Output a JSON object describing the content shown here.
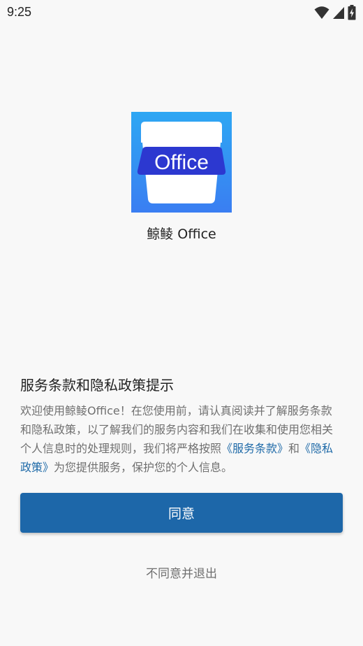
{
  "status_bar": {
    "time": "9:25",
    "icons": [
      "wifi-icon",
      "signal-icon",
      "battery-charging-icon"
    ]
  },
  "app": {
    "logo_text": "Office",
    "name": "鲸鲮 Office",
    "logo_colors": [
      "#2ea7f3",
      "#3a7ef2"
    ],
    "badge_color": "#2c38d0"
  },
  "dialog": {
    "title": "服务条款和隐私政策提示",
    "body_part1": "欢迎使用鲸鲮Office！在您使用前，请认真阅读并了解服务条款和隐私政策，以了解我们的服务内容和我们在收集和使用您相关个人信息时的处理规则，我们将严格按照",
    "terms_link": "《服务条款》",
    "body_part2": "和",
    "privacy_link": "《隐私政策》",
    "body_part3": "为您提供服务，保护您的个人信息。"
  },
  "buttons": {
    "agree": "同意",
    "disagree": "不同意并退出"
  },
  "colors": {
    "primary": "#1d67a9",
    "link": "#1f6aa8",
    "background": "#f8f8f8"
  }
}
